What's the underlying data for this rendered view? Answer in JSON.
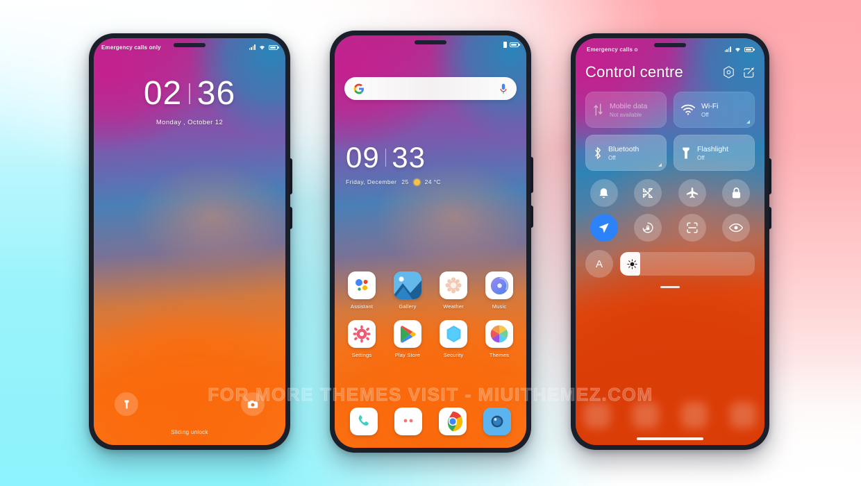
{
  "background": {
    "left_color": "#8cf2fb",
    "right_color": "#ffa8ad",
    "highlight_color": "#ffffff"
  },
  "watermark": {
    "text": "FOR MORE THEMES VISIT - MIUITHEMEZ.COM"
  },
  "phones": [
    {
      "id": "lockscreen",
      "status_bar": {
        "carrier": "Emergency calls only",
        "icons": [
          "signal-icon",
          "wifi-icon",
          "battery-icon"
        ]
      },
      "clock": {
        "hours": "02",
        "minutes": "36",
        "separator": "|"
      },
      "date": "Monday , October 12",
      "bottom": {
        "left_shortcut": "flashlight-icon",
        "right_shortcut": "camera-icon",
        "hint": "Sliding unlock"
      }
    },
    {
      "id": "homescreen",
      "status_bar": {
        "carrier": "",
        "icons": [
          "vibrate-icon",
          "battery-icon"
        ]
      },
      "search": {
        "logo": "google-logo-icon",
        "mic": "microphone-icon",
        "placeholder": ""
      },
      "clock": {
        "hours": "09",
        "minutes": "33",
        "separator": "|"
      },
      "date": "Friday, December",
      "day_number": "25",
      "weather": {
        "icon": "sun-icon",
        "temperature": "24 °C"
      },
      "apps_row1": [
        {
          "label": "Assistant",
          "icon": "assistant-icon"
        },
        {
          "label": "Gallery",
          "icon": "gallery-icon"
        },
        {
          "label": "Weather",
          "icon": "weather-icon"
        },
        {
          "label": "Music",
          "icon": "music-icon"
        }
      ],
      "apps_row2": [
        {
          "label": "Settings",
          "icon": "settings-icon"
        },
        {
          "label": "Play Store",
          "icon": "play-store-icon"
        },
        {
          "label": "Security",
          "icon": "security-icon"
        },
        {
          "label": "Themes",
          "icon": "themes-icon"
        }
      ],
      "dock": [
        {
          "label": "Phone",
          "icon": "phone-icon"
        },
        {
          "label": "Messages",
          "icon": "messages-icon"
        },
        {
          "label": "Chrome",
          "icon": "chrome-icon"
        },
        {
          "label": "Camera",
          "icon": "camera-app-icon"
        }
      ]
    },
    {
      "id": "control-centre",
      "status_bar": {
        "carrier": "Emergency calls o",
        "icons": [
          "signal-icon",
          "wifi-icon",
          "battery-icon"
        ]
      },
      "title": "Control centre",
      "actions": [
        "settings-hex-icon",
        "edit-icon"
      ],
      "tiles": [
        {
          "name": "Mobile data",
          "state": "Not available",
          "icon": "mobile-data-icon",
          "style": "dim",
          "expandable": false
        },
        {
          "name": "Wi-Fi",
          "state": "Off",
          "icon": "wifi-tile-icon",
          "style": "blue",
          "expandable": true
        },
        {
          "name": "Bluetooth",
          "state": "Off",
          "icon": "bluetooth-icon",
          "style": "normal",
          "expandable": true
        },
        {
          "name": "Flashlight",
          "state": "Off",
          "icon": "flashlight-tile-icon",
          "style": "normal",
          "expandable": false
        }
      ],
      "round_toggles": [
        {
          "icon": "bell-icon",
          "active": false
        },
        {
          "icon": "screenshot-icon",
          "active": false
        },
        {
          "icon": "airplane-icon",
          "active": false
        },
        {
          "icon": "lock-icon",
          "active": false
        },
        {
          "icon": "location-icon",
          "active": true
        },
        {
          "icon": "rotation-lock-icon",
          "active": false
        },
        {
          "icon": "scanner-icon",
          "active": false
        },
        {
          "icon": "eye-care-icon",
          "active": false
        }
      ],
      "brightness": {
        "auto_label": "A",
        "level_percent": 15,
        "icon": "brightness-sun-icon"
      },
      "accent_color": "#2e82f7"
    }
  ]
}
